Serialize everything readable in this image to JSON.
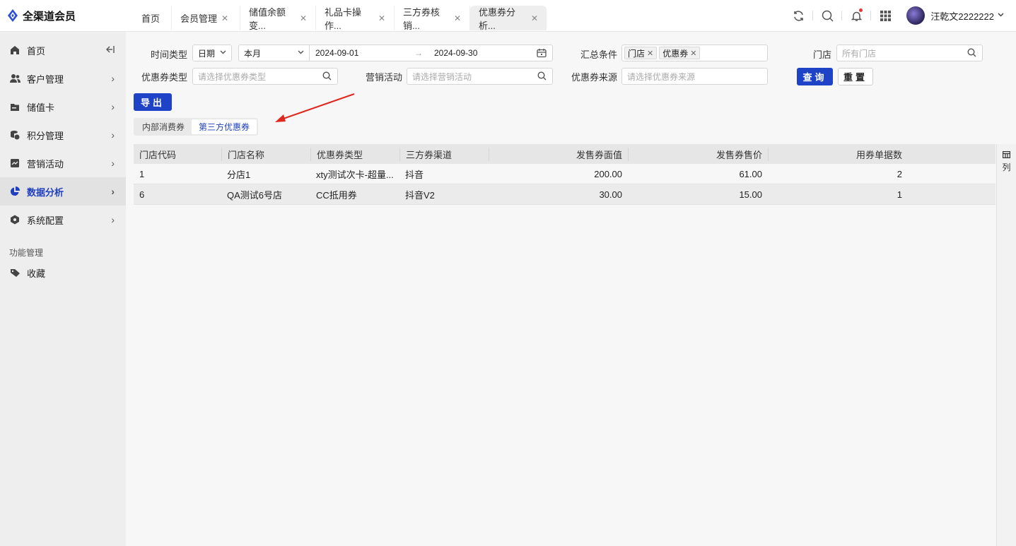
{
  "app": {
    "brand": "全渠道会员"
  },
  "tabs": [
    {
      "label": "首页",
      "closable": false
    },
    {
      "label": "会员管理",
      "closable": true
    },
    {
      "label": "储值余额变...",
      "closable": true
    },
    {
      "label": "礼品卡操作...",
      "closable": true
    },
    {
      "label": "三方券核销...",
      "closable": true
    },
    {
      "label": "优惠券分析...",
      "closable": true,
      "active": true
    }
  ],
  "header": {
    "user_name": "汪乾文2222222",
    "chevron": "⌄"
  },
  "sidebar": {
    "items": [
      {
        "label": "首页",
        "icon": "home-icon"
      },
      {
        "label": "客户管理",
        "icon": "users-icon"
      },
      {
        "label": "储值卡",
        "icon": "card-icon"
      },
      {
        "label": "积分管理",
        "icon": "coins-icon"
      },
      {
        "label": "营销活动",
        "icon": "chart-icon"
      },
      {
        "label": "数据分析",
        "icon": "pie-icon",
        "active": true
      },
      {
        "label": "系统配置",
        "icon": "settings-icon"
      }
    ],
    "section_title": "功能管理",
    "favorites_label": "收藏"
  },
  "filters": {
    "time_type_label": "时间类型",
    "time_type_value": "日期",
    "period_value": "本月",
    "date_start": "2024-09-01",
    "date_arrow": "→",
    "date_end": "2024-09-30",
    "summary_label": "汇总条件",
    "summary_tags": [
      "门店",
      "优惠券"
    ],
    "store_label": "门店",
    "store_placeholder": "所有门店",
    "coupon_type_label": "优惠券类型",
    "coupon_type_placeholder": "请选择优惠券类型",
    "campaign_label": "营销活动",
    "campaign_placeholder": "请选择营销活动",
    "source_label": "优惠券来源",
    "source_placeholder": "请选择优惠券来源",
    "query_label": "查询",
    "reset_label": "重置"
  },
  "actions": {
    "export_label": "导出"
  },
  "segments": [
    {
      "label": "内部消费券"
    },
    {
      "label": "第三方优惠券",
      "active": true
    }
  ],
  "table": {
    "columns": [
      "门店代码",
      "门店名称",
      "优惠券类型",
      "三方券渠道",
      "发售券面值",
      "发售券售价",
      "用券单据数",
      ""
    ],
    "rows": [
      [
        "1",
        "分店1",
        "xty测试次卡-超量...",
        "抖音",
        "200.00",
        "61.00",
        "2",
        ""
      ],
      [
        "6",
        "QA测试6号店",
        "CC抵用券",
        "抖音V2",
        "30.00",
        "15.00",
        "1",
        ""
      ]
    ]
  },
  "column_setting_label": "列",
  "colors": {
    "primary": "#1e43c7",
    "active_nav": "#1f3fbf",
    "annotation_arrow": "#e0281e"
  }
}
